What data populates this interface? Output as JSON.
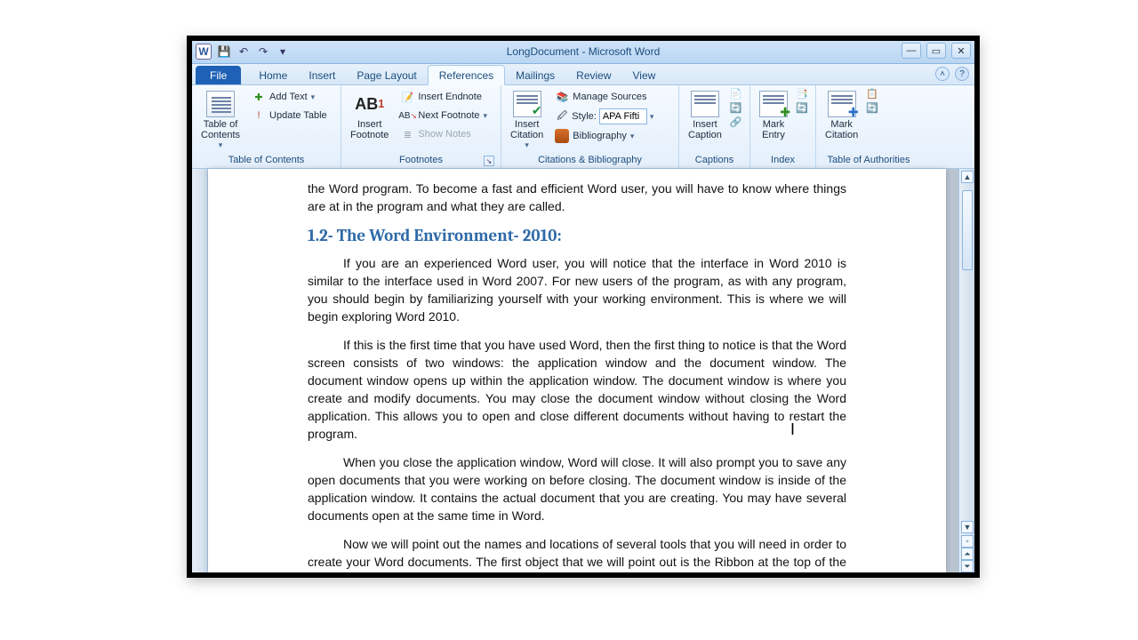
{
  "window": {
    "title": "LongDocument - Microsoft Word"
  },
  "tabs": {
    "file": "File",
    "list": [
      "Home",
      "Insert",
      "Page Layout",
      "References",
      "Mailings",
      "Review",
      "View"
    ],
    "active": "References"
  },
  "ribbon": {
    "toc": {
      "label": "Table of Contents",
      "button": "Table of\nContents",
      "add_text": "Add Text",
      "update": "Update Table"
    },
    "footnotes": {
      "label": "Footnotes",
      "insert_footnote": "Insert\nFootnote",
      "insert_endnote": "Insert Endnote",
      "next_footnote": "Next Footnote",
      "show_notes": "Show Notes"
    },
    "citations": {
      "label": "Citations & Bibliography",
      "insert_citation": "Insert\nCitation",
      "manage_sources": "Manage Sources",
      "style_label": "Style:",
      "style_value": "APA Fifti",
      "bibliography": "Bibliography"
    },
    "captions": {
      "label": "Captions",
      "insert_caption": "Insert\nCaption"
    },
    "index": {
      "label": "Index",
      "mark_entry": "Mark\nEntry"
    },
    "toa": {
      "label": "Table of Authorities",
      "mark_citation": "Mark\nCitation"
    }
  },
  "document": {
    "frag_top": "the Word program. To become a fast and efficient Word user, you will have to know where things are at in the program and what they are called.",
    "heading": "1.2- The Word Environment- 2010:",
    "p1": "If you are an experienced Word user, you will notice that the interface in Word 2010 is similar to the interface used in Word 2007. For new users of the program, as with any program, you should begin by familiarizing yourself with your working environment. This is where we will begin exploring Word 2010.",
    "p2": "If this is the first time that you have used Word, then the first thing to notice is that the Word screen consists of two windows: the application window and the document window. The document window opens up within the application window. The document window is where you create and modify documents. You may close the document window without closing the Word application. This allows you to open and close different documents without having to restart the program.",
    "p3": "When you close the application window, Word will close. It will also prompt you to save any open documents that you were working on before closing. The document window is inside of the application window. It contains the actual document that you are creating. You may have several documents open at the same time in Word.",
    "p4": "Now we will point out the names and locations of several tools that you will need in order to create your Word documents. The first object that we will point out is the Ribbon at the top of the application window. This tool is where you can find all of the tabs, groups, and commands available for"
  }
}
